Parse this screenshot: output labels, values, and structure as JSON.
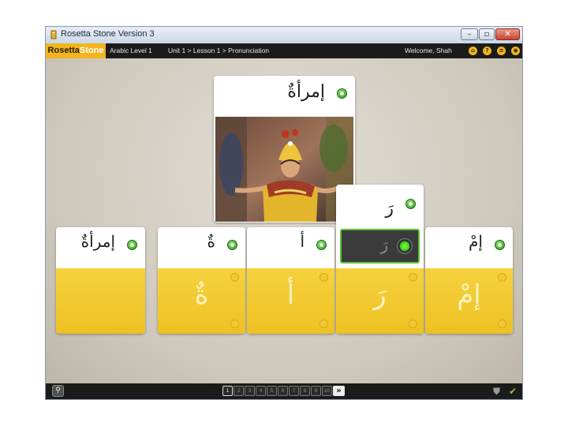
{
  "window": {
    "title": "Rosetta Stone Version 3",
    "controls": {
      "minimize": "–",
      "maximize": "▫",
      "close": "✕"
    }
  },
  "menubar": {
    "brand_part1": "Rosetta",
    "brand_part2": "Stone",
    "course": "Arabic Level 1",
    "breadcrumb": "Unit 1 > Lesson 1 > Pronunciation",
    "welcome": "Welcome, Shah",
    "icons": [
      "home-icon",
      "help-icon",
      "menu-icon",
      "chat-icon"
    ]
  },
  "main": {
    "prompt_card": {
      "word": "إمرأةٌ",
      "image": "woman in traditional Balinese dance costume"
    },
    "syllable_popup": {
      "word": "رَ",
      "recorder_glyph": "رَ"
    },
    "cards": [
      {
        "word": "إمرأةٌ",
        "glyph": ""
      },
      {
        "word": "ةٌ",
        "glyph": "ةٌ"
      },
      {
        "word": "أ",
        "glyph": "أ"
      },
      {
        "word": "",
        "glyph": "رَ"
      },
      {
        "word": "إمْ",
        "glyph": "إمْ"
      }
    ]
  },
  "bottombar": {
    "pages": [
      "1",
      "2",
      "3",
      "4",
      "5",
      "6",
      "7",
      "8",
      "9",
      "10"
    ],
    "active_page": "1",
    "next_label": "»"
  },
  "colors": {
    "brand_yellow": "#f2b51b",
    "card_yellow": "#f2c72f",
    "accent_green": "#3ccf1c",
    "bar_black": "#1b1b1b"
  }
}
